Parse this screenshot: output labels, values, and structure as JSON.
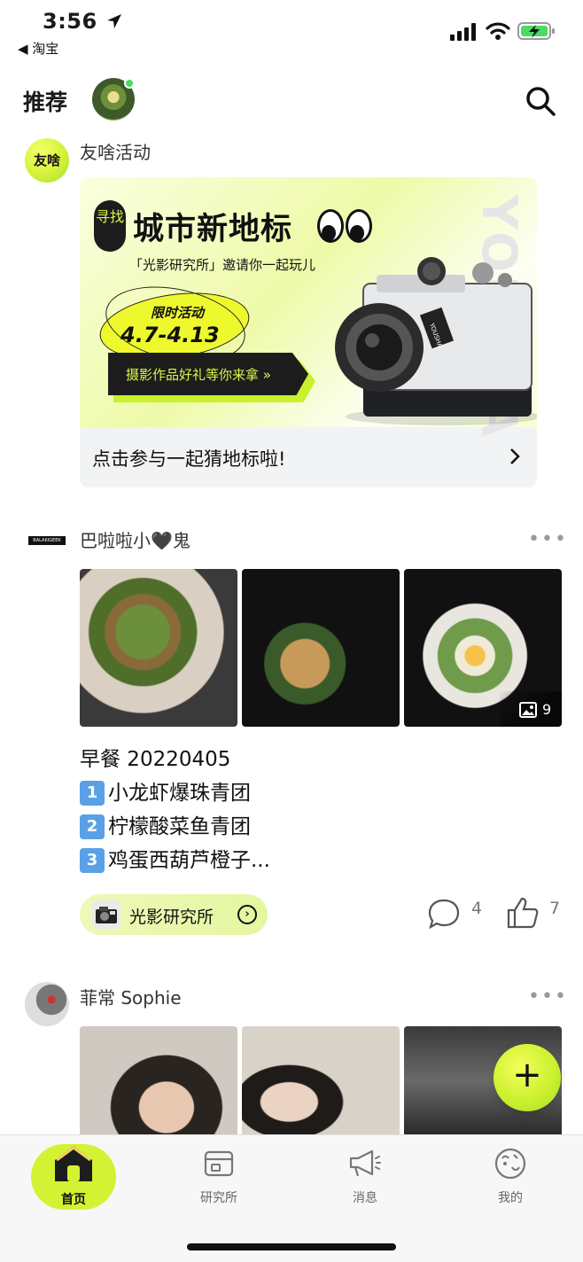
{
  "status_bar": {
    "time": "3:56",
    "back_label": "◀ 淘宝"
  },
  "header": {
    "title": "推荐"
  },
  "activity": {
    "avatar_text": "友啥",
    "name": "友啥活动",
    "banner": {
      "seek": "寻找",
      "title": "城市新地标",
      "subtitle": "「光影研究所」邀请你一起玩儿",
      "limited": "限时活动",
      "dates": "4.7-4.13",
      "cta": "摄影作品好礼等你来拿 »",
      "side_text": "YOUSHA",
      "camera_brand": "YOUSHA"
    },
    "link_text": "点击参与一起猜地标啦!"
  },
  "post1": {
    "avatar_text": "BALAKIGEEK",
    "name": "巴啦啦小🖤鬼",
    "more": "•••",
    "image_count": "9",
    "lines": [
      "早餐 20220405",
      "小龙虾爆珠青团",
      "柠檬酸菜鱼青团",
      "鸡蛋西葫芦橙子..."
    ],
    "nums": [
      "1",
      "2",
      "3"
    ],
    "tag": "光影研究所",
    "comments": "4",
    "likes": "7"
  },
  "post2": {
    "name": "菲常 Sophie",
    "more": "•••"
  },
  "fab": "+",
  "tabs": [
    {
      "label": "首页"
    },
    {
      "label": "研究所"
    },
    {
      "label": "消息"
    },
    {
      "label": "我的"
    }
  ],
  "colors": {
    "accent": "#d4f234",
    "dark": "#1d1d1d"
  }
}
